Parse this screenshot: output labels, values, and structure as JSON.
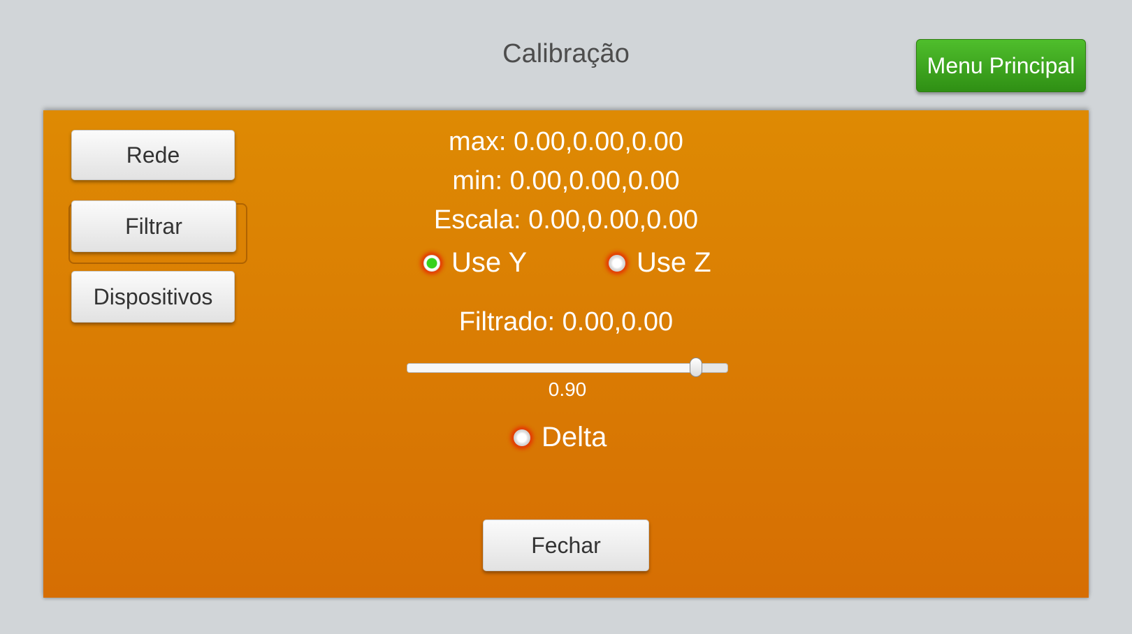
{
  "header": {
    "title": "Calibração"
  },
  "menu_button": {
    "label": "Menu Principal"
  },
  "sidebar": {
    "items": [
      {
        "label": "Rede"
      },
      {
        "label": "Filtrar"
      },
      {
        "label": "Dispositivos"
      }
    ]
  },
  "readouts": {
    "max": "max: 0.00,0.00,0.00",
    "min": "min: 0.00,0.00,0.00",
    "escala": "Escala: 0.00,0.00,0.00"
  },
  "axis_options": [
    {
      "label": "Use Y",
      "selected": true
    },
    {
      "label": "Use Z",
      "selected": false
    }
  ],
  "filtrado": {
    "label": "Filtrado: 0.00,0.00"
  },
  "slider": {
    "value": 0.9,
    "value_text": "0.90",
    "min": 0,
    "max": 1
  },
  "delta": {
    "label": "Delta",
    "selected": false
  },
  "close_button": {
    "label": "Fechar"
  },
  "colors": {
    "panel_orange": "#d97a03",
    "menu_green": "#3fa81f",
    "radio_on": "#37d21c",
    "radio_glow": "#e62800"
  }
}
